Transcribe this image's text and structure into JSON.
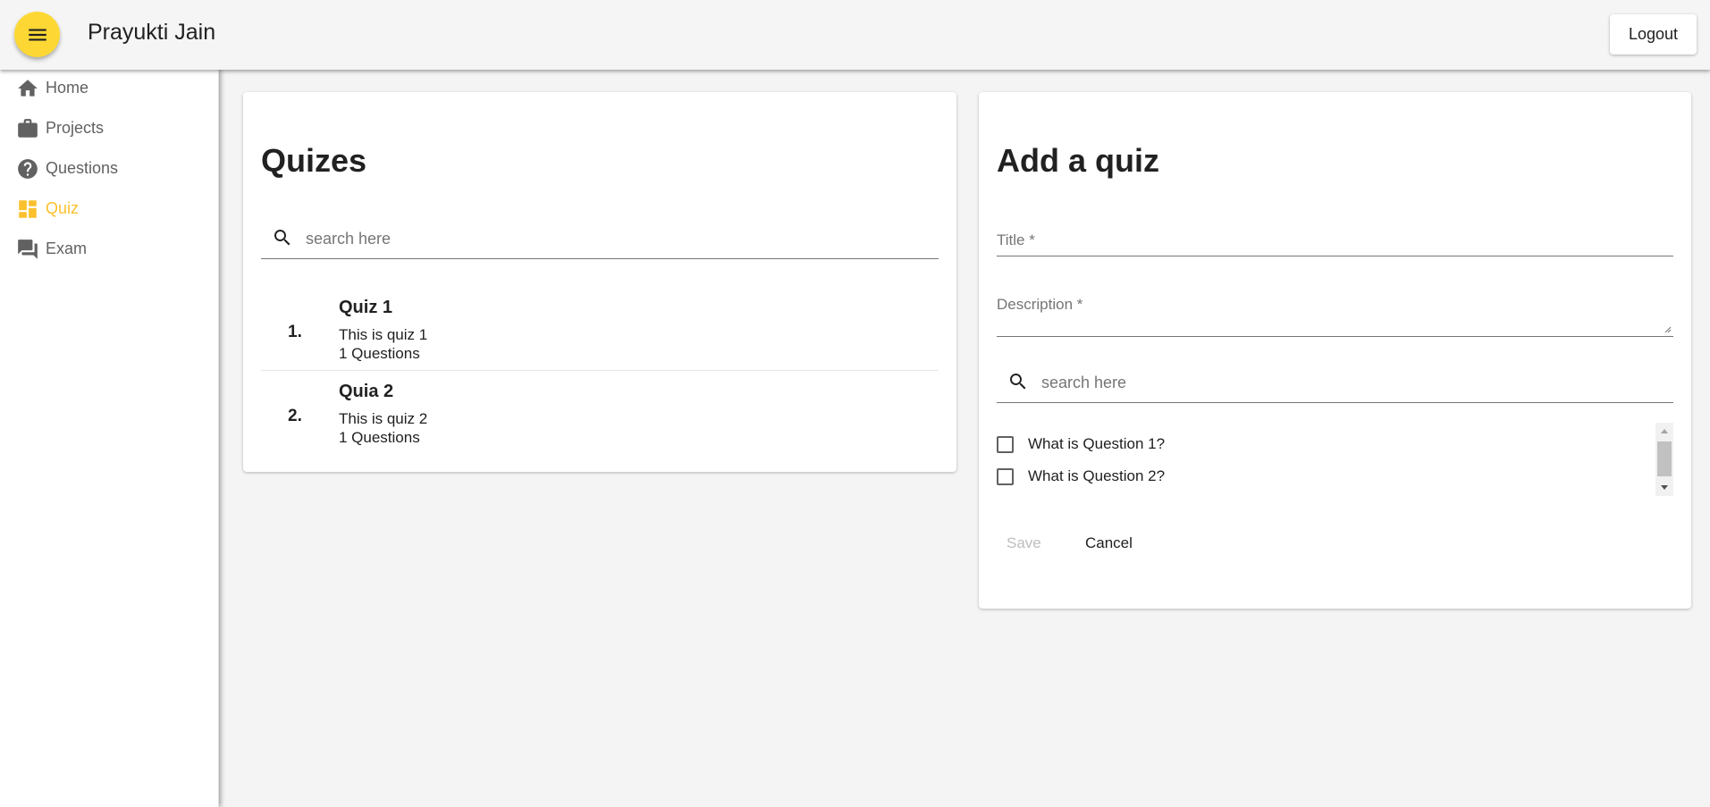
{
  "header": {
    "menu_icon": "menu-icon",
    "user_name": "Prayukti Jain",
    "logout_label": "Logout",
    "accent_color": "#fdd835"
  },
  "sidebar": {
    "items": [
      {
        "label": "Home",
        "icon": "home-icon",
        "active": false
      },
      {
        "label": "Projects",
        "icon": "briefcase-icon",
        "active": false
      },
      {
        "label": "Questions",
        "icon": "help-circle-icon",
        "active": false
      },
      {
        "label": "Quiz",
        "icon": "dashboard-icon",
        "active": true
      },
      {
        "label": "Exam",
        "icon": "forum-icon",
        "active": false
      }
    ],
    "active_color": "#fbc02d"
  },
  "quizzes_panel": {
    "heading": "Quizes",
    "search": {
      "placeholder": "search here",
      "value": ""
    },
    "items": [
      {
        "number": "1.",
        "title": "Quiz 1",
        "description": "This is quiz 1",
        "questions": "1 Questions"
      },
      {
        "number": "2.",
        "title": "Quia 2",
        "description": "This is quiz 2",
        "questions": "1 Questions"
      }
    ]
  },
  "add_quiz_panel": {
    "heading": "Add a quiz",
    "title_field": {
      "label": "Title *",
      "value": ""
    },
    "description_field": {
      "label": "Description *",
      "value": ""
    },
    "search": {
      "placeholder": "search here",
      "value": ""
    },
    "questions": [
      {
        "label": "What is Question 1?",
        "checked": false
      },
      {
        "label": "What is Question 2?",
        "checked": false
      }
    ],
    "save_label": "Save",
    "cancel_label": "Cancel"
  }
}
